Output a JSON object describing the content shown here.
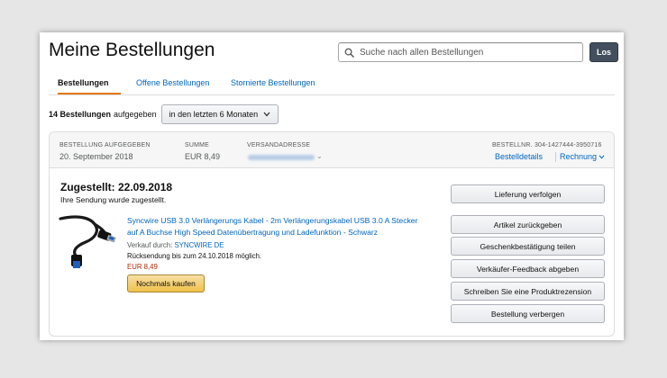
{
  "header": {
    "title": "Meine Bestellungen",
    "search_placeholder": "Suche nach allen Bestellungen",
    "search_button": "Los"
  },
  "tabs": [
    {
      "label": "Bestellungen",
      "active": true
    },
    {
      "label": "Offene Bestellungen",
      "active": false
    },
    {
      "label": "Stornierte Bestellungen",
      "active": false
    }
  ],
  "filter": {
    "count_text": "14 Bestellungen",
    "suffix": "aufgegeben",
    "selected": "in den letzten 6 Monaten"
  },
  "order": {
    "placed_label": "BESTELLUNG AUFGEGEBEN",
    "placed_value": "20. September 2018",
    "total_label": "SUMME",
    "total_value": "EUR 8,49",
    "address_label": "VERSANDADRESSE",
    "order_number": "BESTELLNR. 304-1427444-3950716",
    "details_link": "Bestelldetails",
    "invoice_link": "Rechnung",
    "status": "Zugestellt: 22.09.2018",
    "substatus": "Ihre Sendung wurde zugestellt.",
    "product_title": "Syncwire USB 3.0 Verlängerungs Kabel - 2m Verlängerungskabel USB 3.0 A Stecker auf A Buchse High Speed Datenübertragung und Ladefunktion - Schwarz",
    "seller_label": "Verkauf durch:",
    "seller_name": "SYNCWIRE DE",
    "return_note": "Rücksendung bis zum 24.10.2018 möglich.",
    "price": "EUR 8,49",
    "buy_again": "Nochmals kaufen",
    "actions": [
      "Lieferung verfolgen",
      "Artikel zurückgeben",
      "Geschenkbestätigung teilen",
      "Verkäufer-Feedback abgeben",
      "Schreiben Sie eine Produktrezension",
      "Bestellung verbergen"
    ]
  },
  "colors": {
    "link": "#0066c0",
    "price": "#b12704",
    "tab_underline": "#e47911",
    "buy_button": "#f0c14b",
    "go_button": "#434f5d"
  }
}
